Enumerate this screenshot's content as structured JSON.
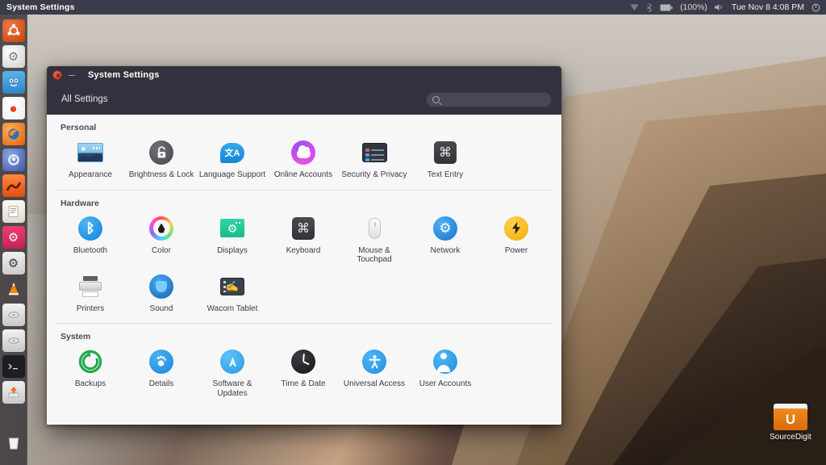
{
  "panel": {
    "title": "System Settings",
    "battery_percent": "(100%)",
    "clock": "Tue Nov  8  4:08 PM",
    "indicators": [
      {
        "name": "wifi-icon",
        "glyph": "▲"
      },
      {
        "name": "bluetooth-indicator-icon",
        "glyph": "ᛦ"
      },
      {
        "name": "battery-icon",
        "glyph": "▬"
      },
      {
        "name": "volume-icon",
        "glyph": "ὐA"
      },
      {
        "name": "power-menu-icon",
        "glyph": "⏻"
      }
    ]
  },
  "launcher": {
    "items": [
      {
        "name": "launcher-item-ubuntu-dash",
        "label": "Ubuntu Dash",
        "glyph": "●",
        "color": "#dd4814"
      },
      {
        "name": "launcher-item-system-settings",
        "label": "System Settings",
        "glyph": "⚙",
        "color": "#e8e8e8"
      },
      {
        "name": "launcher-item-files",
        "label": "Files",
        "glyph": "☰",
        "color": "#3d9bdd"
      },
      {
        "name": "launcher-item-media-player",
        "label": "Media Player",
        "glyph": "●",
        "color": "#f2f2f2"
      },
      {
        "name": "launcher-item-firefox",
        "label": "Firefox",
        "glyph": "◔",
        "color": "#e8751a"
      },
      {
        "name": "launcher-item-browser",
        "label": "Web Browser",
        "glyph": "○",
        "color": "#5b79c8"
      },
      {
        "name": "launcher-item-gimp",
        "label": "Image Editor",
        "glyph": "▲",
        "color": "#f0622a"
      },
      {
        "name": "launcher-item-text-editor",
        "label": "Text Editor",
        "glyph": "☰",
        "color": "#efefe6"
      },
      {
        "name": "launcher-item-settings-pink",
        "label": "Settings",
        "glyph": "⚙",
        "color": "#e0366c"
      },
      {
        "name": "launcher-item-tweak-tool",
        "label": "Tweak Tool",
        "glyph": "⚙",
        "color": "#4a4a4a"
      },
      {
        "name": "launcher-item-vlc",
        "label": "VLC",
        "glyph": "▲",
        "color": "#f08000"
      },
      {
        "name": "launcher-item-disk-1",
        "label": "Disk",
        "glyph": "◉",
        "color": "#dcdcdc"
      },
      {
        "name": "launcher-item-disk-2",
        "label": "Disk",
        "glyph": "◉",
        "color": "#dcdcdc"
      },
      {
        "name": "launcher-item-terminal",
        "label": "Terminal",
        "glyph": "␣",
        "color": "#2b2b2b"
      },
      {
        "name": "launcher-item-software-updater",
        "label": "Software Updater",
        "glyph": "↓",
        "color": "#e8751a"
      }
    ],
    "trash": {
      "name": "launcher-item-trash",
      "label": "Trash",
      "glyph": "Ὕ1"
    }
  },
  "window": {
    "title": "System Settings",
    "all_settings_label": "All Settings",
    "search": {
      "value": "",
      "placeholder": ""
    },
    "sections": [
      {
        "title": "Personal",
        "tiles": [
          {
            "label": "Appearance",
            "icon": "appearance-icon"
          },
          {
            "label": "Brightness & Lock",
            "icon": "brightness-lock-icon",
            "glyph": "🔓"
          },
          {
            "label": "Language Support",
            "icon": "language-support-icon",
            "glyph": "文A"
          },
          {
            "label": "Online Accounts",
            "icon": "online-accounts-icon"
          },
          {
            "label": "Security & Privacy",
            "icon": "security-privacy-icon"
          },
          {
            "label": "Text Entry",
            "icon": "text-entry-icon",
            "glyph": "⌘"
          }
        ]
      },
      {
        "title": "Hardware",
        "tiles": [
          {
            "label": "Bluetooth",
            "icon": "bluetooth-icon",
            "glyph": "ᛦ"
          },
          {
            "label": "Color",
            "icon": "color-icon"
          },
          {
            "label": "Displays",
            "icon": "displays-icon",
            "glyph": "⚙"
          },
          {
            "label": "Keyboard",
            "icon": "keyboard-icon",
            "glyph": "⌘"
          },
          {
            "label": "Mouse & Touchpad",
            "icon": "mouse-touchpad-icon"
          },
          {
            "label": "Network",
            "icon": "network-icon",
            "glyph": "⚙"
          },
          {
            "label": "Power",
            "icon": "power-icon",
            "glyph": "⚡"
          },
          {
            "label": "Printers",
            "icon": "printers-icon"
          },
          {
            "label": "Sound",
            "icon": "sound-icon"
          },
          {
            "label": "Wacom Tablet",
            "icon": "wacom-tablet-icon",
            "glyph": "✋"
          }
        ]
      },
      {
        "title": "System",
        "tiles": [
          {
            "label": "Backups",
            "icon": "backups-icon",
            "glyph": "↺"
          },
          {
            "label": "Details",
            "icon": "details-icon",
            "glyph": "👣"
          },
          {
            "label": "Software & Updates",
            "icon": "software-updates-icon",
            "glyph": "A"
          },
          {
            "label": "Time & Date",
            "icon": "time-date-icon"
          },
          {
            "label": "Universal Access",
            "icon": "universal-access-icon",
            "glyph": "⛹"
          },
          {
            "label": "User Accounts",
            "icon": "user-accounts-icon"
          }
        ]
      }
    ]
  },
  "desktop": {
    "folder": {
      "label": "SourceDigit",
      "glyph": "U"
    }
  },
  "colors": {
    "panel_bg": "#3b3c4a",
    "titlebar_bg": "#32323e",
    "window_bg": "#f7f7f7",
    "accent_orange": "#dd4814"
  }
}
